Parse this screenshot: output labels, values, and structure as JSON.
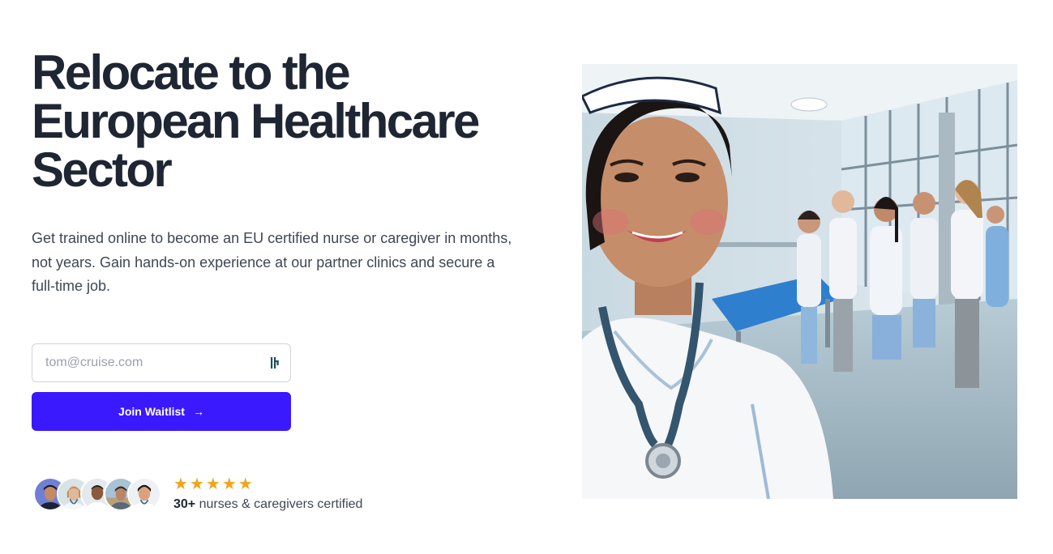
{
  "hero": {
    "headline": "Relocate to the European Healthcare Sector",
    "subtext": "Get trained online to become an EU certified nurse or caregiver in months, not years. Gain hands-on experience at our partner clinics and secure a full-time job.",
    "email": {
      "placeholder": "tom@cruise.com",
      "value": ""
    },
    "cta_label": "Join Waitlist",
    "cta_icon": "arrow-right-icon",
    "accent_color": "#3a19ff"
  },
  "social_proof": {
    "avatar_count": 5,
    "rating_stars": 5,
    "star_color": "#f2a31b",
    "count": "30+",
    "label": "nurses & caregivers certified"
  }
}
